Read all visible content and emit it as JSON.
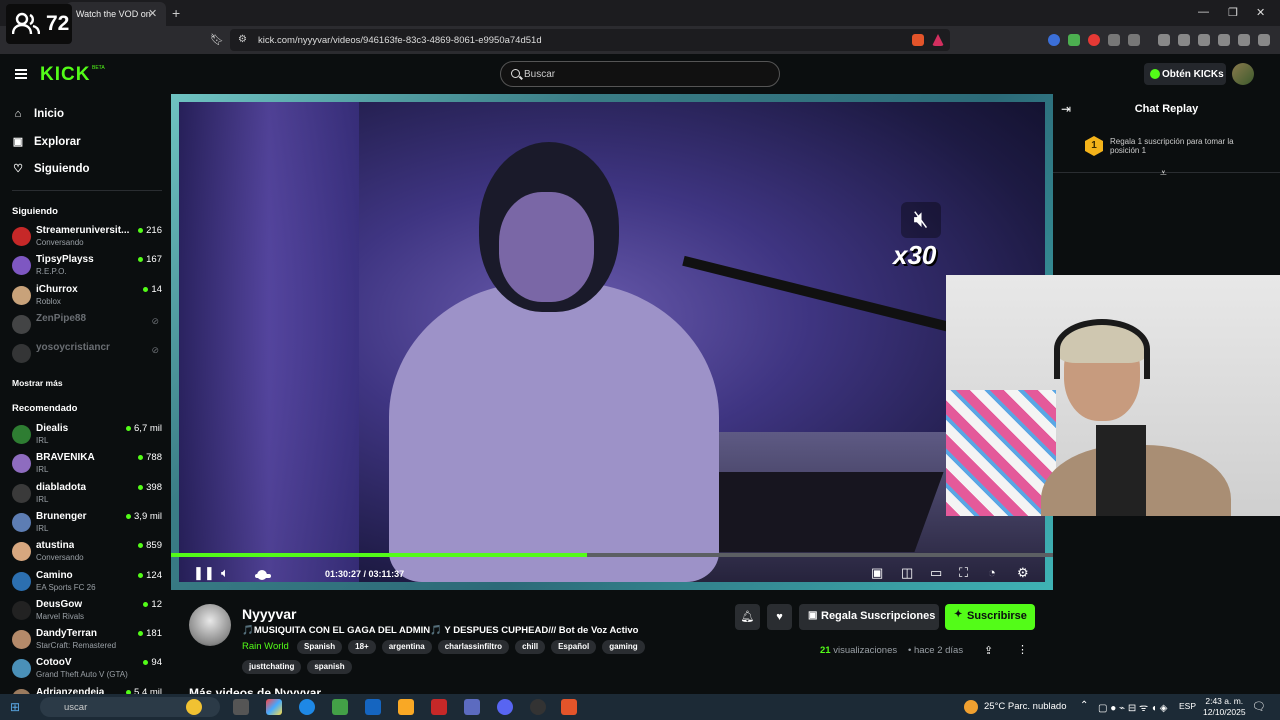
{
  "browser": {
    "viewer_count": "72",
    "tab_title": "Watch the VOD on",
    "url": "kick.com/nyyyvar/videos/946163fe-83c3-4869-8061-e9950a74d51d"
  },
  "header": {
    "logo": "KICK",
    "beta": "BETA",
    "search_placeholder": "Buscar",
    "kicks_label": "Obtén KICKs"
  },
  "sidebar": {
    "nav": [
      {
        "label": "Inicio",
        "icon": "home-icon"
      },
      {
        "label": "Explorar",
        "icon": "compass-icon"
      },
      {
        "label": "Siguiendo",
        "icon": "heart-icon"
      }
    ],
    "following_title": "Siguiendo",
    "following": [
      {
        "name": "Streameruniversit...",
        "category": "Conversando",
        "viewers": "216",
        "color": "#c62828"
      },
      {
        "name": "TipsyPlayss",
        "category": "R.E.P.O.",
        "viewers": "167",
        "color": "#7e57c2"
      },
      {
        "name": "iChurrox",
        "category": "Roblox",
        "viewers": "14",
        "color": "#c8a27a"
      },
      {
        "name": "ZenPipe88",
        "category": "",
        "viewers": "",
        "color": "#888888",
        "offline": true
      },
      {
        "name": "yosoycristiancr",
        "category": "",
        "viewers": "",
        "color": "#666666",
        "offline": true
      }
    ],
    "show_more": "Mostrar más",
    "recommended_title": "Recomendado",
    "recommended": [
      {
        "name": "Diealis",
        "category": "IRL",
        "viewers": "6,7 mil",
        "color": "#2e7d32"
      },
      {
        "name": "BRAVENIKA",
        "category": "IRL",
        "viewers": "788",
        "color": "#8e6cbf"
      },
      {
        "name": "diabladota",
        "category": "IRL",
        "viewers": "398",
        "color": "#3a3a3a"
      },
      {
        "name": "Brunenger",
        "category": "IRL",
        "viewers": "3,9 mil",
        "color": "#5d7db3"
      },
      {
        "name": "atustina",
        "category": "Conversando",
        "viewers": "859",
        "color": "#d7a77f"
      },
      {
        "name": "Camino",
        "category": "EA Sports FC 26",
        "viewers": "124",
        "color": "#2c6fb0"
      },
      {
        "name": "DeusGow",
        "category": "Marvel Rivals",
        "viewers": "12",
        "color": "#222222"
      },
      {
        "name": "DandyTerran",
        "category": "StarCraft: Remastered",
        "viewers": "181",
        "color": "#b48a6a"
      },
      {
        "name": "CotooV",
        "category": "Grand Theft Auto V (GTA)",
        "viewers": "94",
        "color": "#4a90b8"
      },
      {
        "name": "Adrianzendeja",
        "category": "",
        "viewers": "5,4 mil",
        "color": "#9b7b5f"
      }
    ]
  },
  "player": {
    "speed_label": "x30",
    "current_time": "01:30:27",
    "duration": "03:11:37",
    "progress": 0.472
  },
  "chat": {
    "title": "Chat Replay",
    "gift_rank": "1",
    "gift_text": "Regala 1 suscripción para tomar la posición 1"
  },
  "stream": {
    "streamer": "Nyyyvar",
    "title": "🎵MUSIQUITA CON EL GAGA DEL ADMIN🎵 Y DESPUES CUPHEAD/// Bot de Voz Activo",
    "game": "Rain World",
    "tags": [
      "Spanish",
      "18+",
      "argentina",
      "charlassinfiltro",
      "chill",
      "Español",
      "gaming",
      "justtchating",
      "spanish"
    ],
    "gift_subs_label": "Regala Suscripciones",
    "subscribe_label": "Suscribirse",
    "views_count": "21",
    "views_label": "visualizaciones",
    "ago": "hace 2 días",
    "more_videos": "Más videos de Nyyyvar"
  },
  "taskbar": {
    "search_placeholder": "uscar",
    "weather": "25°C  Parc. nublado",
    "lang": "ESP",
    "time": "2:43 a. m.",
    "date": "12/10/2025"
  }
}
